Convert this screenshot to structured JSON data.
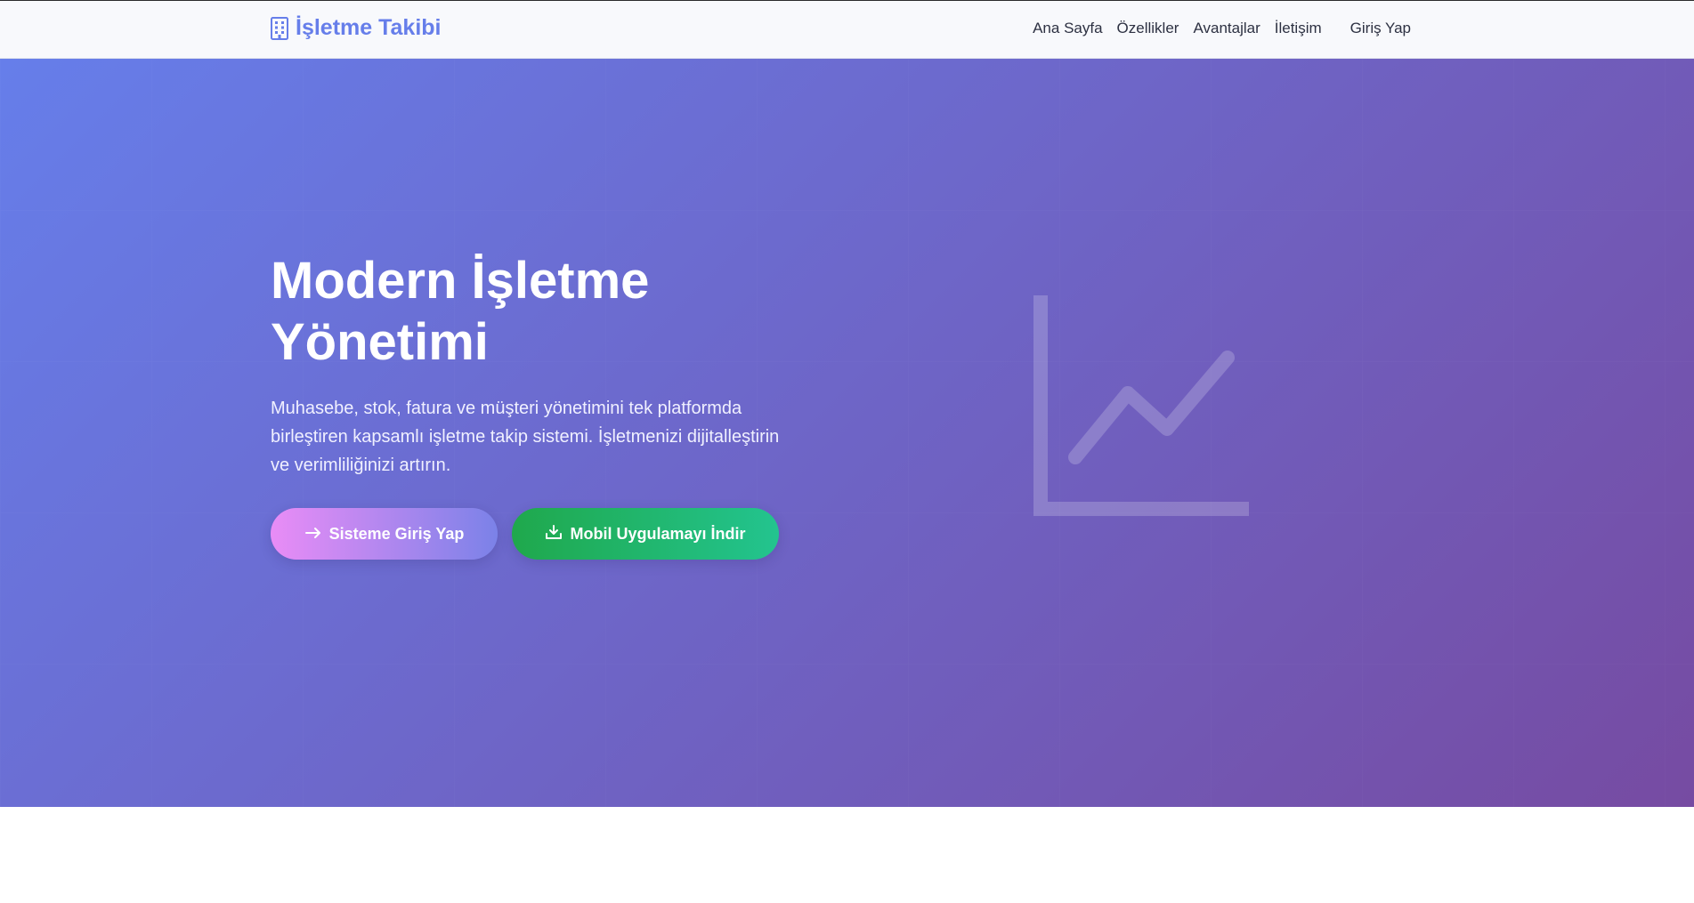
{
  "brand": {
    "name": "İşletme Takibi",
    "icon": "building-icon",
    "color": "#667eea"
  },
  "nav": {
    "links": [
      {
        "label": "Ana Sayfa"
      },
      {
        "label": "Özellikler"
      },
      {
        "label": "Avantajlar"
      },
      {
        "label": "İletişim"
      }
    ],
    "login_label": "Giriş Yap"
  },
  "hero": {
    "title": "Modern İşletme Yönetimi",
    "subtitle": "Muhasebe, stok, fatura ve müşteri yönetimini tek platformda birleştiren kapsamlı işletme takip sistemi. İşletmenizi dijitalleştirin ve verimliliğinizi artırın.",
    "gradient_start": "#667eea",
    "gradient_end": "#764ba2",
    "decoration_icon": "chart-line-icon",
    "buttons": {
      "primary": {
        "label": "Sisteme Giriş Yap",
        "icon": "arrow-right-icon"
      },
      "secondary": {
        "label": "Mobil Uygulamayı İndir",
        "icon": "download-icon",
        "color": "#22b864"
      }
    }
  }
}
